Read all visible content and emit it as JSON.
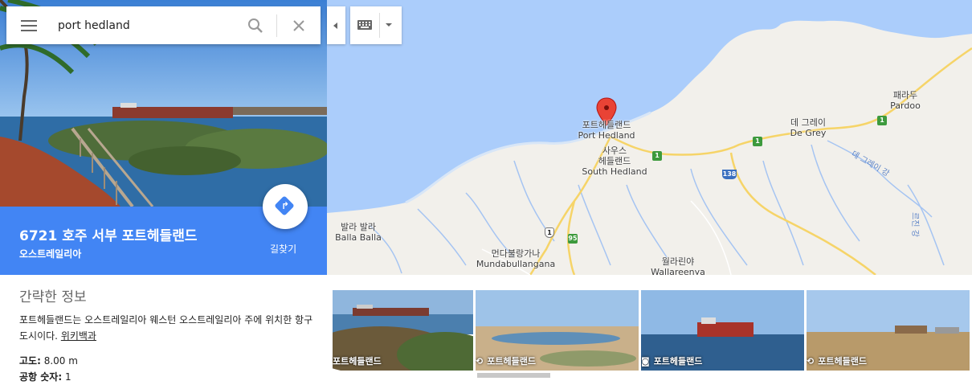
{
  "search": {
    "value": "port hedland"
  },
  "place": {
    "title": "6721 호주 서부 포트헤들랜드",
    "subtitle": "오스트레일리아",
    "directions_label": "길찾기"
  },
  "info": {
    "heading": "간략한 정보",
    "description": "포트헤들랜드는 오스트레일리아 웨스턴 오스트레일리아 주에 위치한 항구 도시이다.",
    "wiki_link": "위키백과",
    "facts": [
      {
        "label": "고도:",
        "value": "8.00 m"
      },
      {
        "label": "공항 숫자:",
        "value": "1"
      }
    ]
  },
  "map": {
    "labels": {
      "port_hedland_ko": "포트헤들랜드",
      "port_hedland_en": "Port Hedland",
      "south_hedland_ko1": "사우스",
      "south_hedland_ko2": "헤들랜드",
      "south_hedland_en": "South Hedland",
      "de_grey_ko": "데 그레이",
      "de_grey_en": "De Grey",
      "pardoo_ko": "패라두",
      "pardoo_en": "Pardoo",
      "balla_ko": "발라 발라",
      "balla_en": "Balla Balla",
      "mundabullangana_ko": "먼다불랑가나",
      "mundabullangana_en": "Mundabullangana",
      "wallareenya_ko": "월라린야",
      "wallareenya_en": "Wallareenya",
      "de_grey_river": "데 그레이 강",
      "river2": "르진 강"
    },
    "shields": [
      "1",
      "1",
      "1",
      "138",
      "1",
      "95"
    ]
  },
  "photos": [
    {
      "caption": "포트헤들랜드",
      "icon": ""
    },
    {
      "caption": "포트헤들랜드",
      "icon": "360-icon"
    },
    {
      "caption": "포트헤들랜드",
      "icon": "camera-icon"
    },
    {
      "caption": "포트헤들랜드",
      "icon": "360-icon"
    }
  ],
  "colors": {
    "accent": "#4285f4",
    "water": "#abcdfb",
    "land": "#f2f0eb",
    "pin": "#e94335"
  }
}
